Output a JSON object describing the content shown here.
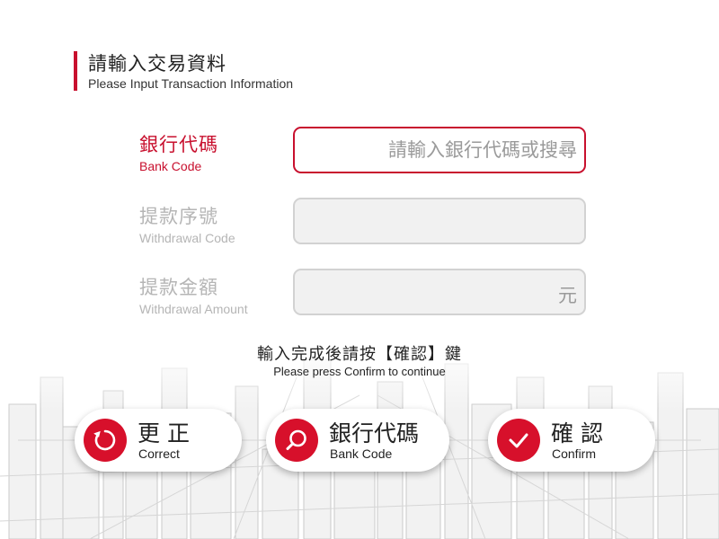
{
  "header": {
    "title_zh": "請輸入交易資料",
    "title_en": "Please Input Transaction Information"
  },
  "fields": [
    {
      "label_zh": "銀行代碼",
      "label_en": "Bank Code",
      "placeholder": "請輸入銀行代碼或搜尋",
      "value": "",
      "active": true
    },
    {
      "label_zh": "提款序號",
      "label_en": "Withdrawal Code",
      "placeholder": "",
      "value": "",
      "active": false
    },
    {
      "label_zh": "提款金額",
      "label_en": "Withdrawal Amount",
      "placeholder": "",
      "value": "",
      "unit": "元",
      "active": false
    }
  ],
  "prompt": {
    "zh": "輸入完成後請按【確認】鍵",
    "en": "Please press Confirm to continue"
  },
  "buttons": {
    "correct": {
      "zh": "更 正",
      "en": "Correct",
      "icon": "refresh-icon"
    },
    "bank_code": {
      "zh": "銀行代碼",
      "en": "Bank Code",
      "icon": "search-icon"
    },
    "confirm": {
      "zh": "確 認",
      "en": "Confirm",
      "icon": "check-icon"
    }
  },
  "colors": {
    "accent": "#c8102e",
    "button_circle": "#d7102b",
    "inactive_label": "#b5b5b5",
    "inactive_field": "#f1f1f1"
  }
}
